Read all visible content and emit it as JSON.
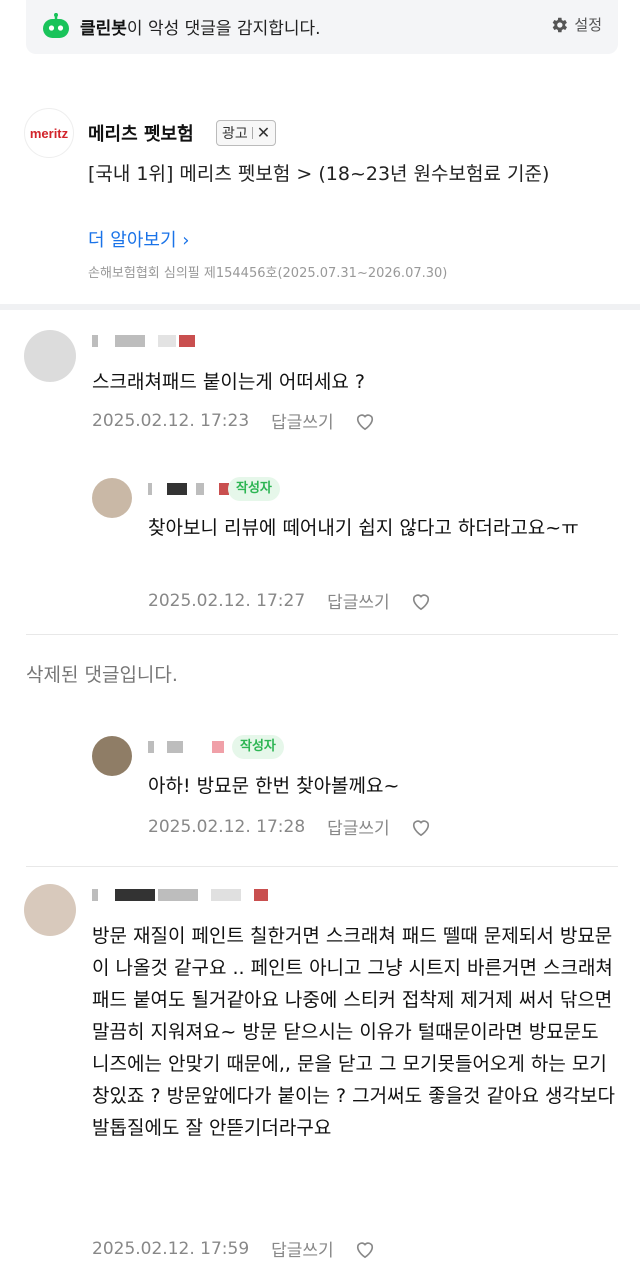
{
  "cleanbot": {
    "name": "클린봇",
    "message": "이 악성 댓글을 감지합니다.",
    "settings_label": "설정",
    "brand_color": "#19c35a"
  },
  "ad": {
    "logo_text": "meritz",
    "advertiser": "메리츠 펫보험",
    "badge_label": "광고",
    "description": "[국내 1위] 메리츠 펫보험 > (18~23년 원수보험료 기준)",
    "more_link": "더 알아보기",
    "disclaimer": "손해보험협회 심의필 제154456호(2025.07.31~2026.07.30)"
  },
  "comments": [
    {
      "text": "스크래쳐패드 붙이는게 어떠세요 ?",
      "date": "2025.02.12. 17:23",
      "reply_label": "답글쓰기"
    },
    {
      "is_reply": true,
      "writer_badge": "작성자",
      "text": "찾아보니 리뷰에 떼어내기 쉽지 않다고 하더라고요~ㅠ",
      "date": "2025.02.12. 17:27",
      "reply_label": "답글쓰기"
    },
    {
      "deleted_text": "삭제된 댓글입니다."
    },
    {
      "is_reply": true,
      "writer_badge": "작성자",
      "text": "아하! 방묘문 한번 찾아볼께요~",
      "date": "2025.02.12. 17:28",
      "reply_label": "답글쓰기"
    },
    {
      "text": "방문 재질이 페인트 칠한거면 스크래쳐 패드 뗄때 문제되서 방묘문이 나올것 같구요 .. 페인트 아니고 그냥 시트지 바른거면 스크래쳐 패드 붙여도 될거같아요 나중에 스티커 접착제 제거제 써서 닦으면 말끔히 지워져요~ 방문 닫으시는 이유가 털때문이라면 방묘문도 니즈에는 안맞기 때문에,, 문을 닫고 그 모기못들어오게 하는 모기창있죠 ? 방문앞에다가 붙이는 ? 그거써도 좋을것 같아요 생각보다 발톱질에도 잘 안뜯기더라구요",
      "date": "2025.02.12. 17:59",
      "reply_label": "답글쓰기"
    }
  ]
}
